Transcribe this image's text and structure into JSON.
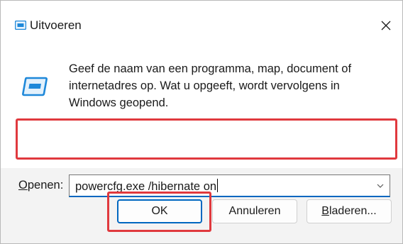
{
  "window": {
    "title": "Uitvoeren",
    "title_icon": "run-icon",
    "close_glyph": "✕"
  },
  "content": {
    "app_icon": "run-icon",
    "description": "Geef de naam van een programma, map, document of internetadres op. Wat u opgeeft, wordt vervolgens in Windows geopend."
  },
  "open_field": {
    "label_accesskey": "O",
    "label_rest": "penen:",
    "value": "powercfg.exe /hibernate on",
    "dropdown_icon": "chevron-down-icon"
  },
  "buttons": {
    "ok_label": "OK",
    "cancel_label": "Annuleren",
    "browse_accesskey": "B",
    "browse_rest": "laderen..."
  },
  "colors": {
    "accent": "#0067c0",
    "highlight": "#e0393e",
    "icon_blue": "#1e88d9"
  }
}
